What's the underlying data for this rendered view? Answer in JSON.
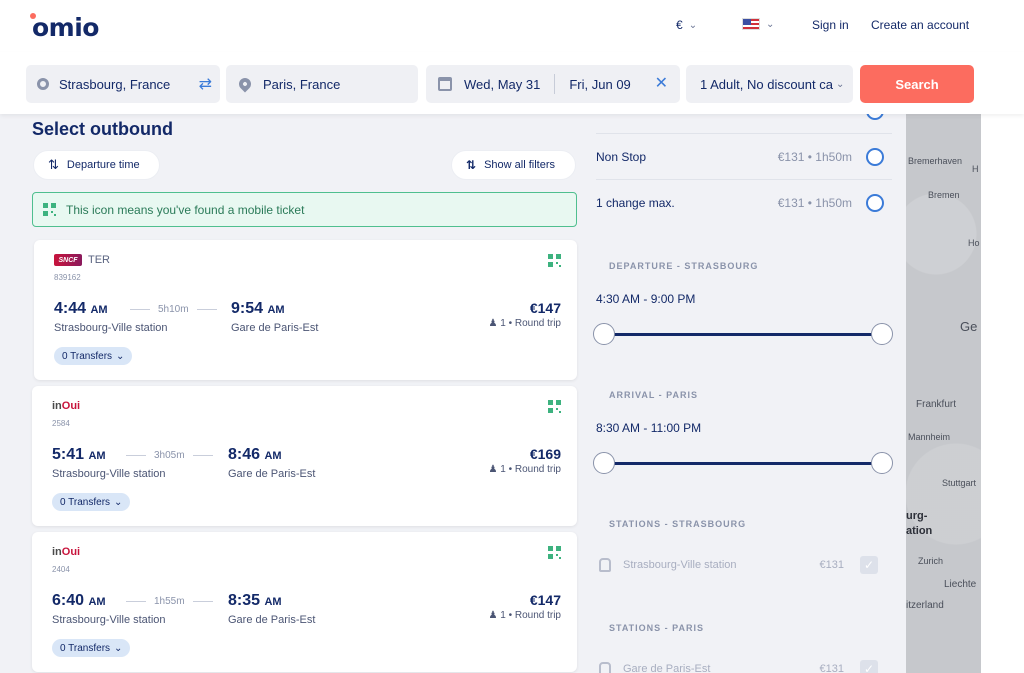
{
  "header": {
    "logo": "omio",
    "currency": "€",
    "sign_in": "Sign in",
    "create_account": "Create an account"
  },
  "search": {
    "from": "Strasbourg, France",
    "to": "Paris, France",
    "depart_date": "Wed, May 31",
    "return_date": "Fri, Jun 09",
    "passengers": "1 Adult, No discount ca",
    "search_label": "Search"
  },
  "results": {
    "title": "Select outbound",
    "sort_label": "Departure time",
    "filters_label": "Show all filters",
    "mobile_notice": "This icon means you've found a mobile ticket",
    "journeys": [
      {
        "operator": "TER",
        "operator_logo": "SNCF",
        "train_number": "839162",
        "dep_time": "4:44",
        "dep_ampm": "AM",
        "duration": "5h10m",
        "arr_time": "9:54",
        "arr_ampm": "AM",
        "dep_station": "Strasbourg-Ville station",
        "arr_station": "Gare de Paris-Est",
        "price": "€147",
        "trip": "1 • Round trip",
        "transfers": "0 Transfers"
      },
      {
        "operator_logo": "inOui",
        "train_number": "2584",
        "dep_time": "5:41",
        "dep_ampm": "AM",
        "duration": "3h05m",
        "arr_time": "8:46",
        "arr_ampm": "AM",
        "dep_station": "Strasbourg-Ville station",
        "arr_station": "Gare de Paris-Est",
        "price": "€169",
        "trip": "1 • Round trip",
        "transfers": "0 Transfers"
      },
      {
        "operator_logo": "inOui",
        "train_number": "2404",
        "dep_time": "6:40",
        "dep_ampm": "AM",
        "duration": "1h55m",
        "arr_time": "8:35",
        "arr_ampm": "AM",
        "dep_station": "Strasbourg-Ville station",
        "arr_station": "Gare de Paris-Est",
        "price": "€147",
        "trip": "1 • Round trip",
        "transfers": "0 Transfers"
      }
    ]
  },
  "filters": {
    "stops": [
      {
        "label": "Non Stop",
        "value": "€131 • 1h50m"
      },
      {
        "label": "1 change max.",
        "value": "€131 • 1h50m"
      }
    ],
    "departure_section": "DEPARTURE - STRASBOURG",
    "departure_range": "4:30 AM - 9:00 PM",
    "arrival_section": "ARRIVAL - PARIS",
    "arrival_range": "8:30 AM - 11:00 PM",
    "stations_from_section": "STATIONS - STRASBOURG",
    "station_from": {
      "name": "Strasbourg-Ville station",
      "price": "€131"
    },
    "stations_to_section": "STATIONS - PARIS",
    "station_to": {
      "name": "Gare de Paris-Est",
      "price": "€131"
    }
  },
  "map": {
    "labels": [
      "Bremerhaven",
      "Bremen",
      "Frankfurt",
      "Mannheim",
      "Stuttgart",
      "Zurich",
      "Liechte",
      "itzerland",
      "urg-",
      "ation",
      "Ge",
      "Ho",
      "H"
    ]
  },
  "colors": {
    "brand_navy": "#132968",
    "search_button": "#fc6c5f",
    "accent_blue": "#3b7bd8",
    "mobile_green": "#3db27f"
  }
}
